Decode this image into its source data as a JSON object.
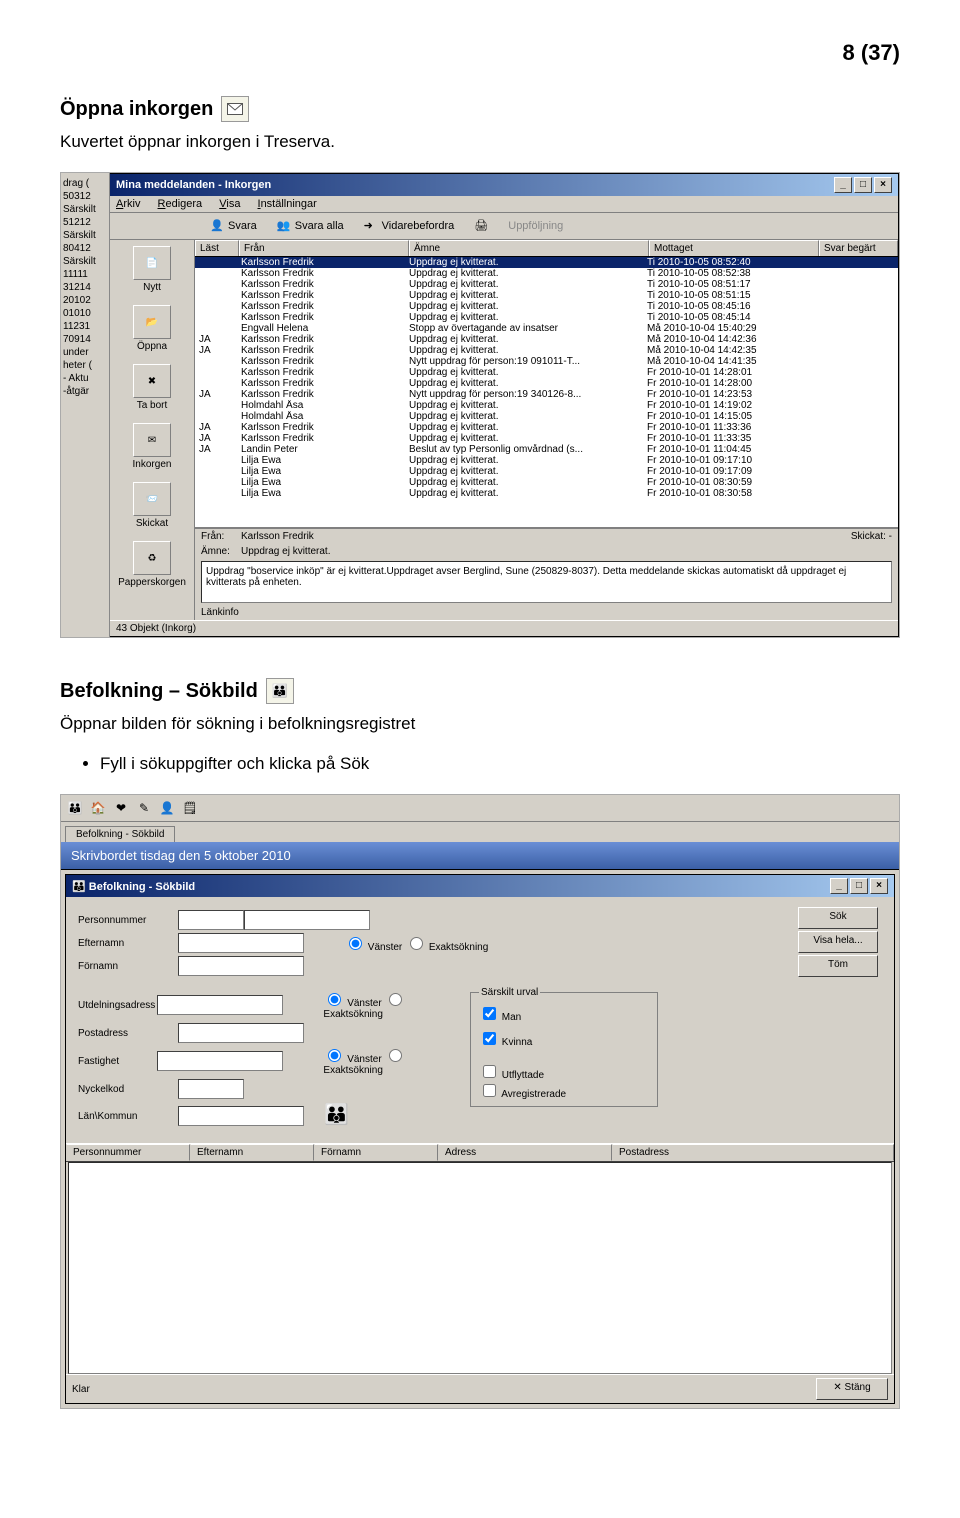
{
  "page_number": "8 (37)",
  "section1": {
    "heading": "Öppna inkorgen",
    "text": "Kuvertet öppnar inkorgen i Treserva."
  },
  "inbox": {
    "left_strip": [
      "drag (",
      "50312",
      "Särskilt",
      "51212",
      "Särskilt",
      "80412",
      "Särskilt",
      "11111",
      "31214",
      "20102",
      "01010",
      "11231",
      "70914",
      "under",
      "heter (",
      "- Aktu",
      "-åtgär"
    ],
    "title": "Mina meddelanden - Inkorgen",
    "menu": [
      "Arkiv",
      "Redigera",
      "Visa",
      "Inställningar"
    ],
    "toolbar": {
      "svara": "Svara",
      "svara_alla": "Svara alla",
      "vidare": "Vidarebefordra",
      "uppfolj": "Uppföljning"
    },
    "columns": {
      "last": "Läst",
      "from": "Från",
      "subj": "Ämne",
      "recv": "Mottaget",
      "resp": "Svar begärt"
    },
    "sidebar": [
      {
        "label": "Nytt"
      },
      {
        "label": "Öppna"
      },
      {
        "label": "Ta bort"
      },
      {
        "label": "Inkorgen"
      },
      {
        "label": "Skickat"
      },
      {
        "label": "Papperskorgen"
      }
    ],
    "rows": [
      {
        "last": "",
        "from": "Karlsson Fredrik",
        "subj": "Uppdrag ej kvitterat.",
        "recv": "Ti 2010-10-05 08:52:40",
        "sel": true
      },
      {
        "last": "",
        "from": "Karlsson Fredrik",
        "subj": "Uppdrag ej kvitterat.",
        "recv": "Ti 2010-10-05 08:52:38"
      },
      {
        "last": "",
        "from": "Karlsson Fredrik",
        "subj": "Uppdrag ej kvitterat.",
        "recv": "Ti 2010-10-05 08:51:17"
      },
      {
        "last": "",
        "from": "Karlsson Fredrik",
        "subj": "Uppdrag ej kvitterat.",
        "recv": "Ti 2010-10-05 08:51:15"
      },
      {
        "last": "",
        "from": "Karlsson Fredrik",
        "subj": "Uppdrag ej kvitterat.",
        "recv": "Ti 2010-10-05 08:45:16"
      },
      {
        "last": "",
        "from": "Karlsson Fredrik",
        "subj": "Uppdrag ej kvitterat.",
        "recv": "Ti 2010-10-05 08:45:14"
      },
      {
        "last": "",
        "from": "Engvall Helena",
        "subj": "Stopp av övertagande av insatser",
        "recv": "Må 2010-10-04 15:40:29"
      },
      {
        "last": "JA",
        "from": "Karlsson Fredrik",
        "subj": "Uppdrag ej kvitterat.",
        "recv": "Må 2010-10-04 14:42:36"
      },
      {
        "last": "JA",
        "from": "Karlsson Fredrik",
        "subj": "Uppdrag ej kvitterat.",
        "recv": "Må 2010-10-04 14:42:35"
      },
      {
        "last": "",
        "from": "Karlsson Fredrik",
        "subj": "Nytt uppdrag för person:19 091011-T...",
        "recv": "Må 2010-10-04 14:41:35"
      },
      {
        "last": "",
        "from": "Karlsson Fredrik",
        "subj": "Uppdrag ej kvitterat.",
        "recv": "Fr 2010-10-01 14:28:01"
      },
      {
        "last": "",
        "from": "Karlsson Fredrik",
        "subj": "Uppdrag ej kvitterat.",
        "recv": "Fr 2010-10-01 14:28:00"
      },
      {
        "last": "JA",
        "from": "Karlsson Fredrik",
        "subj": "Nytt uppdrag för person:19 340126-8...",
        "recv": "Fr 2010-10-01 14:23:53"
      },
      {
        "last": "",
        "from": "Holmdahl Åsa",
        "subj": "Uppdrag ej kvitterat.",
        "recv": "Fr 2010-10-01 14:19:02"
      },
      {
        "last": "",
        "from": "Holmdahl Åsa",
        "subj": "Uppdrag ej kvitterat.",
        "recv": "Fr 2010-10-01 14:15:05"
      },
      {
        "last": "JA",
        "from": "Karlsson Fredrik",
        "subj": "Uppdrag ej kvitterat.",
        "recv": "Fr 2010-10-01 11:33:36"
      },
      {
        "last": "JA",
        "from": "Karlsson Fredrik",
        "subj": "Uppdrag ej kvitterat.",
        "recv": "Fr 2010-10-01 11:33:35"
      },
      {
        "last": "JA",
        "from": "Landin Peter",
        "subj": "Beslut av typ Personlig omvårdnad (s...",
        "recv": "Fr 2010-10-01 11:04:45"
      },
      {
        "last": "",
        "from": "Lilja Ewa",
        "subj": "Uppdrag ej kvitterat.",
        "recv": "Fr 2010-10-01 09:17:10"
      },
      {
        "last": "",
        "from": "Lilja Ewa",
        "subj": "Uppdrag ej kvitterat.",
        "recv": "Fr 2010-10-01 09:17:09"
      },
      {
        "last": "",
        "from": "Lilja Ewa",
        "subj": "Uppdrag ej kvitterat.",
        "recv": "Fr 2010-10-01 08:30:59"
      },
      {
        "last": "",
        "from": "Lilja Ewa",
        "subj": "Uppdrag ej kvitterat.",
        "recv": "Fr 2010-10-01 08:30:58"
      }
    ],
    "preview": {
      "from_label": "Från:",
      "from_value": "Karlsson Fredrik",
      "subj_label": "Ämne:",
      "subj_value": "Uppdrag ej kvitterat.",
      "sent_label": "Skickat:",
      "sent_value": "-",
      "body": "Uppdrag \"boservice inköp\" är ej kvitterat.Uppdraget avser Berglind, Sune (250829-8037). Detta meddelande skickas automatiskt då uppdraget ej kvitterats på enheten."
    },
    "linkinfo": "Länkinfo",
    "status": "43 Objekt (Inkorg)"
  },
  "section2": {
    "heading": "Befolkning – Sökbild",
    "text": "Öppnar bilden för sökning i befolkningsregistret",
    "bullet": "Fyll i sökuppgifter och klicka på Sök"
  },
  "sokbild": {
    "banner": "Skrivbordet tisdag den 5 oktober 2010",
    "tab": "Befolkning - Sökbild",
    "title": "Befolkning - Sökbild",
    "labels": {
      "pnr": "Personnummer",
      "eft": "Efternamn",
      "for": "Förnamn",
      "utd": "Utdelningsadress",
      "post": "Postadress",
      "fast": "Fastighet",
      "nyck": "Nyckelkod",
      "lan": "Län\\Kommun"
    },
    "radios": {
      "van": "Vänster",
      "exakt": "Exaktsökning"
    },
    "buttons": {
      "sok": "Sök",
      "visa": "Visa hela...",
      "tom": "Töm",
      "stang": "Stäng"
    },
    "group": {
      "legend": "Särskilt urval",
      "man": "Man",
      "kvinna": "Kvinna",
      "utf": "Utflyttade",
      "avreg": "Avregistrerade"
    },
    "result_cols": [
      "Personnummer",
      "Efternamn",
      "Förnamn",
      "Adress",
      "Postadress"
    ],
    "status": "Klar"
  }
}
